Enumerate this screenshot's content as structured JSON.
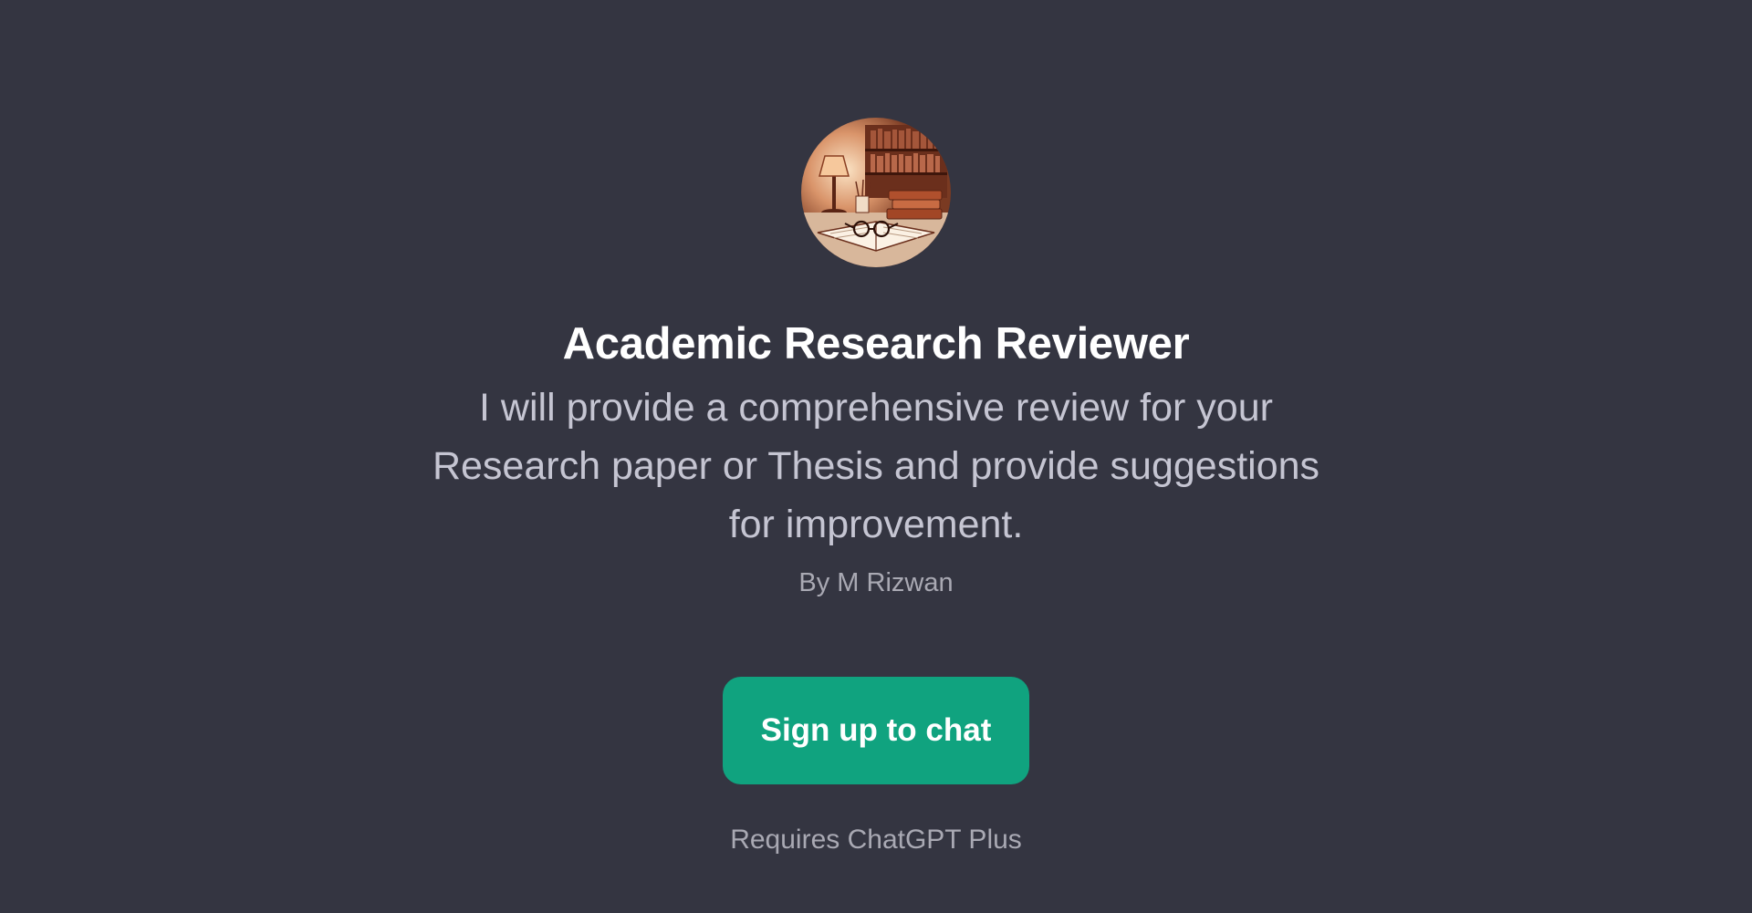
{
  "gpt": {
    "title": "Academic Research Reviewer",
    "description": "I will provide a comprehensive review for your Research paper or Thesis and provide suggestions for improvement.",
    "author": "By M Rizwan",
    "avatar_icon": "library-desk-illustration-icon"
  },
  "cta": {
    "signup_label": "Sign up to chat",
    "requirement_note": "Requires ChatGPT Plus"
  },
  "colors": {
    "background": "#343541",
    "accent": "#10a37f",
    "title": "#ffffff",
    "body_text": "#c5c5d2",
    "muted_text": "#a9a9b3"
  }
}
